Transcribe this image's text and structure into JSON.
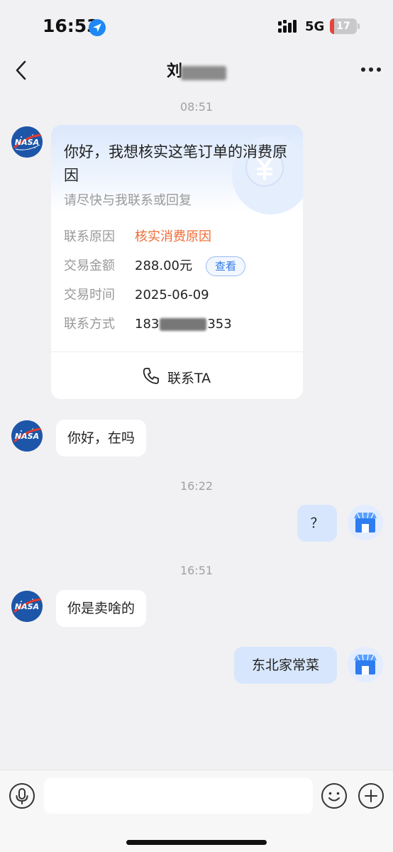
{
  "status_bar": {
    "time": "16:53",
    "network": "5G",
    "battery_level": "17",
    "battery_fraction": 0.17
  },
  "nav": {
    "title": "刘"
  },
  "messages": {
    "timestamp_1": "08:51",
    "card": {
      "title": "你好，我想核实这笔订单的消费原因",
      "subtitle": "请尽快与我联系或回复",
      "rows": [
        {
          "label": "联系原因",
          "value": "核实消费原因"
        },
        {
          "label": "交易金额",
          "value": "288.00元",
          "action": "查看"
        },
        {
          "label": "交易时间",
          "value": "2025-06-09"
        },
        {
          "label": "联系方式",
          "value_prefix": "183",
          "value_suffix": "353"
        }
      ],
      "contact_label": "联系TA"
    },
    "bubble_1": "你好，在吗",
    "timestamp_2": "16:22",
    "bubble_2": "？",
    "timestamp_3": "16:51",
    "bubble_3": "你是卖啥的",
    "bubble_4": "东北家常菜"
  },
  "icons": {
    "location": "location-arrow-icon",
    "back": "chevron-left-icon",
    "more": "more-dots-icon",
    "phone": "phone-icon",
    "mic": "microphone-icon",
    "emoji": "emoji-icon",
    "plus": "plus-icon",
    "avatar_other": "nasa-logo-avatar",
    "avatar_self": "shop-storefront-avatar"
  },
  "colors": {
    "accent_orange": "#f06a33",
    "accent_blue": "#2f78e8",
    "outgoing_bubble": "#d7e6fc",
    "battery_low": "#e5463c"
  },
  "input": {
    "placeholder": ""
  }
}
